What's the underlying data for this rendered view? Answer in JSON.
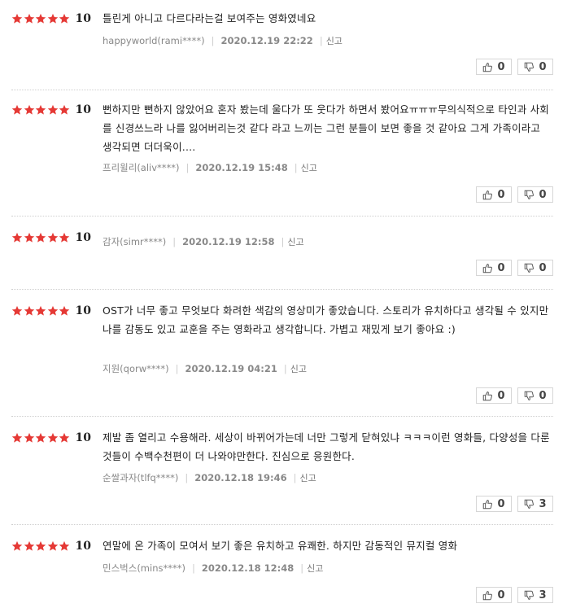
{
  "reviews": [
    {
      "score": "10",
      "text": "틀린게 아니고 다르다라는걸 보여주는 영화였네요",
      "user": "happyworld(rami****)",
      "date": "2020.12.19 22:22",
      "report": "신고",
      "like_count": "0",
      "dislike_count": "0"
    },
    {
      "score": "10",
      "text": "뻔하지만 뻔하지 않았어요 혼자 봤는데 울다가 또 웃다가 하면서 봤어요ㅠㅠㅠ무의식적으로 타인과 사회를 신경쓰느라 나를 잃어버리는것 같다 라고 느끼는 그런 분들이 보면 좋을 것 같아요 그게 가족이라고 생각되면 더더욱이....",
      "user": "프리윌리(aliv****)",
      "date": "2020.12.19 15:48",
      "report": "신고",
      "like_count": "0",
      "dislike_count": "0"
    },
    {
      "score": "10",
      "text": "",
      "user": "감자(simr****)",
      "date": "2020.12.19 12:58",
      "report": "신고",
      "like_count": "0",
      "dislike_count": "0"
    },
    {
      "score": "10",
      "text": "OST가 너무 좋고 무엇보다 화려한 색감의 영상미가 좋았습니다. 스토리가 유치하다고 생각될 수 있지만 나를 감동도 있고 교훈을 주는 영화라고 생각합니다. 가볍고 재밌게 보기 좋아요 :)",
      "user": "지원(qorw****)",
      "date": "2020.12.19 04:21",
      "report": "신고",
      "like_count": "0",
      "dislike_count": "0"
    },
    {
      "score": "10",
      "text": "제발 좀 열리고 수용해라. 세상이 바뀌어가는데 너만 그렇게 닫혀있냐 ㅋㅋㅋ이런 영화들, 다양성을 다룬 것들이 수백수천편이 더 나와야만한다. 진심으로 응원한다.",
      "user": "순쌀과자(tlfq****)",
      "date": "2020.12.18 19:46",
      "report": "신고",
      "like_count": "0",
      "dislike_count": "3"
    },
    {
      "score": "10",
      "text": "연말에 온 가족이 모여서 보기 좋은 유치하고 유쾌한. 하지만 감동적인 뮤지컬 영화",
      "user": "민스벅스(mins****)",
      "date": "2020.12.18 12:48",
      "report": "신고",
      "like_count": "0",
      "dislike_count": "3"
    }
  ],
  "colors": {
    "star": "#e53935",
    "border": "#d6d6d6",
    "meta": "#888888"
  },
  "icons": {
    "like": "thumbs-up-icon",
    "dislike": "thumbs-down-icon"
  }
}
